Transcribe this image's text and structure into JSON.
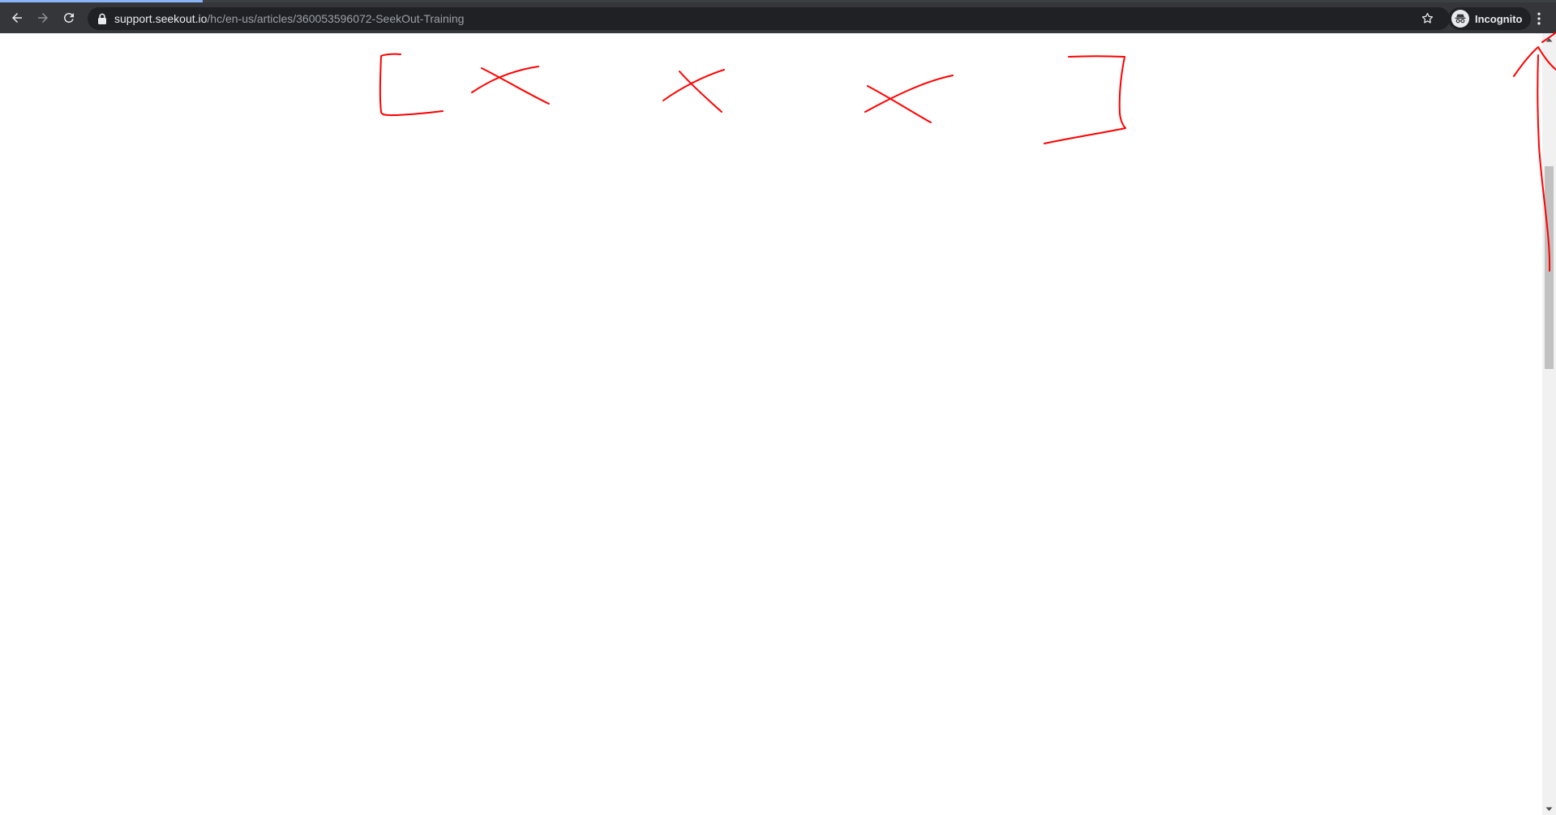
{
  "browser": {
    "url_host": "support.seekout.io",
    "url_path": "/hc/en-us/articles/360053596072-SeekOut-Training",
    "profile_label": "Incognito"
  },
  "icons": {
    "back": "arrow-left-icon",
    "forward": "arrow-right-icon",
    "reload": "reload-icon",
    "lock": "lock-icon",
    "bookmark": "star-icon",
    "profile": "incognito-icon",
    "menu": "kebab-menu-icon"
  },
  "colors": {
    "toolbar": "#35363a",
    "omnibox": "#202124",
    "annotation_ink": "#ff0000",
    "accent": "#8ab4f8"
  },
  "scroll": {
    "position": 0.22
  }
}
